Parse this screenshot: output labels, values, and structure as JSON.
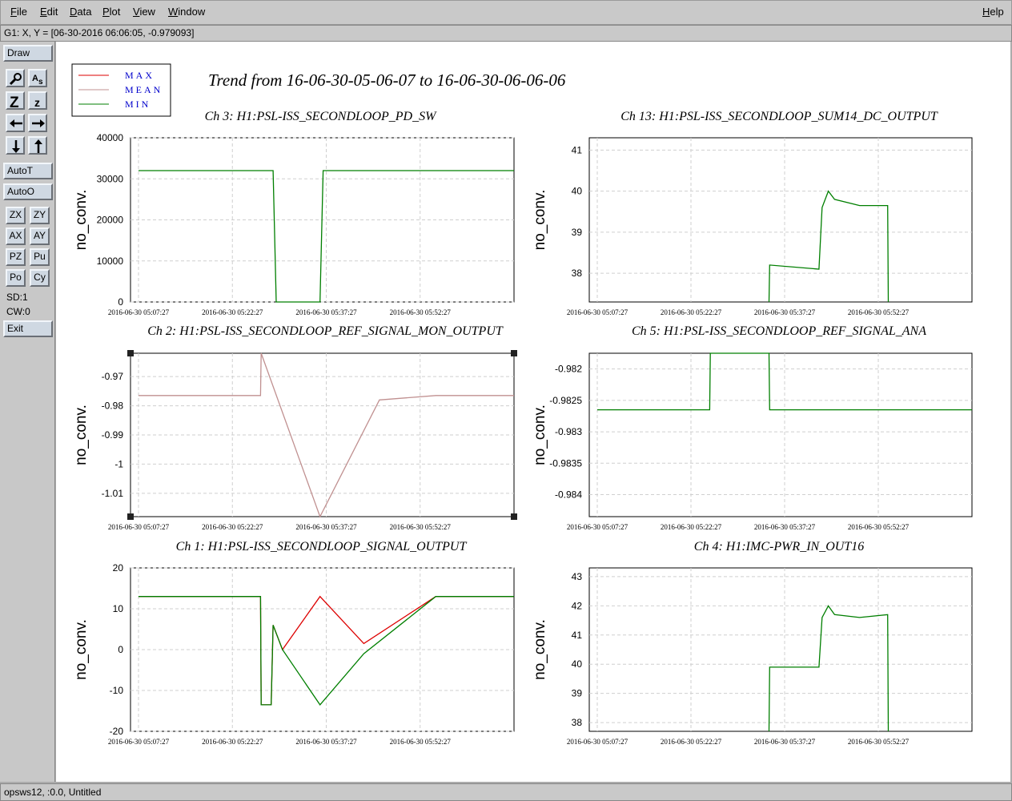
{
  "menu": {
    "file": "File",
    "edit": "Edit",
    "data": "Data",
    "plot": "Plot",
    "view": "View",
    "window": "Window",
    "help": "Help"
  },
  "coords": "G1: X, Y = [06-30-2016 06:06:05, -0.979093]",
  "toolbar": {
    "draw": "Draw",
    "autot": "AutoT",
    "autoo": "AutoO",
    "zx": "ZX",
    "zy": "ZY",
    "ax": "AX",
    "ay": "AY",
    "pz": "PZ",
    "pu": "Pu",
    "po": "Po",
    "cy": "Cy",
    "sd": "SD:1",
    "cw": "CW:0",
    "exit": "Exit"
  },
  "status": "opsws12, :0.0, Untitled",
  "main_title": "Trend from 16-06-30-05-06-07 to 16-06-30-06-06-06",
  "legend": [
    "MAX",
    "MEAN",
    "MIN"
  ],
  "colors": {
    "max": "#dd0000",
    "mean": "#c09090",
    "min": "#007f00",
    "legend_text": "#0000cc"
  },
  "chart_data": [
    {
      "type": "line",
      "title": "Ch 3: H1:PSL-ISS_SECONDLOOP_PD_SW",
      "ylabel": "no_conv.",
      "xticks": [
        "2016-06-30 05:07:27",
        "2016-06-30 05:22:27",
        "2016-06-30 05:37:27",
        "2016-06-30 05:52:27"
      ],
      "yticks": [
        "40000",
        "30000",
        "20000",
        "10000",
        "0"
      ],
      "ylim": [
        0,
        40000
      ],
      "series": [
        {
          "name": "MIN",
          "x_min": [
            0,
            21.5,
            22,
            29,
            29.5,
            60
          ],
          "values": [
            32000,
            32000,
            0,
            0,
            32000,
            32000
          ]
        }
      ]
    },
    {
      "type": "line",
      "title": "Ch 13: H1:PSL-ISS_SECONDLOOP_SUM14_DC_OUTPUT",
      "ylabel": "no_conv.",
      "xticks": [
        "2016-06-30 05:07:27",
        "2016-06-30 05:22:27",
        "2016-06-30 05:37:27",
        "2016-06-30 05:52:27"
      ],
      "yticks": [
        "41",
        "40",
        "39",
        "38"
      ],
      "ylim": [
        37.3,
        41.3
      ],
      "series": [
        {
          "name": "MIN",
          "x_min": [
            27.5,
            27.6,
            35.5,
            36,
            37,
            38,
            42,
            46.5,
            46.6
          ],
          "values": [
            37.3,
            38.2,
            38.1,
            39.6,
            40.0,
            39.8,
            39.65,
            39.65,
            37.3
          ]
        }
      ]
    },
    {
      "type": "line",
      "title": "Ch 2: H1:PSL-ISS_SECONDLOOP_REF_SIGNAL_MON_OUTPUT",
      "ylabel": "no_conv.",
      "xticks": [
        "2016-06-30 05:07:27",
        "2016-06-30 05:22:27",
        "2016-06-30 05:37:27",
        "2016-06-30 05:52:27"
      ],
      "yticks": [
        "-0.97",
        "-0.98",
        "-0.99",
        "-1",
        "-1.01"
      ],
      "ylim": [
        -1.018,
        -0.962
      ],
      "series": [
        {
          "name": "MEAN",
          "x_min": [
            0,
            19.5,
            19.6,
            29,
            38.5,
            47.5,
            60
          ],
          "values": [
            -0.9765,
            -0.9765,
            -0.962,
            -1.018,
            -0.978,
            -0.9765,
            -0.9765
          ]
        }
      ]
    },
    {
      "type": "line",
      "title": "Ch 5: H1:PSL-ISS_SECONDLOOP_REF_SIGNAL_ANA",
      "ylabel": "no_conv.",
      "xticks": [
        "2016-06-30 05:07:27",
        "2016-06-30 05:22:27",
        "2016-06-30 05:37:27",
        "2016-06-30 05:52:27"
      ],
      "yticks": [
        "-0.982",
        "-0.9825",
        "-0.983",
        "-0.9835",
        "-0.984"
      ],
      "ylim": [
        -0.98435,
        -0.98175
      ],
      "series": [
        {
          "name": "MIN",
          "x_min": [
            0,
            18,
            18.1,
            27.5,
            27.6,
            60
          ],
          "values": [
            -0.98265,
            -0.98265,
            -0.98175,
            -0.98175,
            -0.98265,
            -0.98265
          ]
        }
      ]
    },
    {
      "type": "line",
      "title": "Ch 1: H1:PSL-ISS_SECONDLOOP_SIGNAL_OUTPUT",
      "ylabel": "no_conv.",
      "xticks": [
        "2016-06-30 05:07:27",
        "2016-06-30 05:22:27",
        "2016-06-30 05:37:27",
        "2016-06-30 05:52:27"
      ],
      "yticks": [
        "20",
        "10",
        "0",
        "-10",
        "-20"
      ],
      "ylim": [
        -20,
        20
      ],
      "series": [
        {
          "name": "MAX",
          "x_min": [
            0,
            19.5,
            19.6,
            21.2,
            21.5,
            23,
            29,
            36,
            47.5,
            60
          ],
          "values": [
            13,
            13,
            -13.5,
            -13.5,
            6,
            0,
            13,
            1.5,
            13,
            13
          ]
        },
        {
          "name": "MIN",
          "x_min": [
            0,
            19.5,
            19.6,
            21.2,
            21.5,
            23,
            29,
            36,
            47.5,
            60
          ],
          "values": [
            13,
            13,
            -13.5,
            -13.5,
            6,
            0,
            -13.5,
            -1,
            13,
            13
          ]
        }
      ]
    },
    {
      "type": "line",
      "title": "Ch 4: H1:IMC-PWR_IN_OUT16",
      "ylabel": "no_conv.",
      "xticks": [
        "2016-06-30 05:07:27",
        "2016-06-30 05:22:27",
        "2016-06-30 05:37:27",
        "2016-06-30 05:52:27"
      ],
      "yticks": [
        "43",
        "42",
        "41",
        "40",
        "39",
        "38"
      ],
      "ylim": [
        37.7,
        43.3
      ],
      "series": [
        {
          "name": "MIN",
          "x_min": [
            27.5,
            27.6,
            35.5,
            36,
            37,
            38,
            42,
            46.5,
            46.6
          ],
          "values": [
            37.7,
            39.9,
            39.9,
            41.6,
            42.0,
            41.7,
            41.6,
            41.7,
            37.7
          ]
        }
      ]
    }
  ]
}
